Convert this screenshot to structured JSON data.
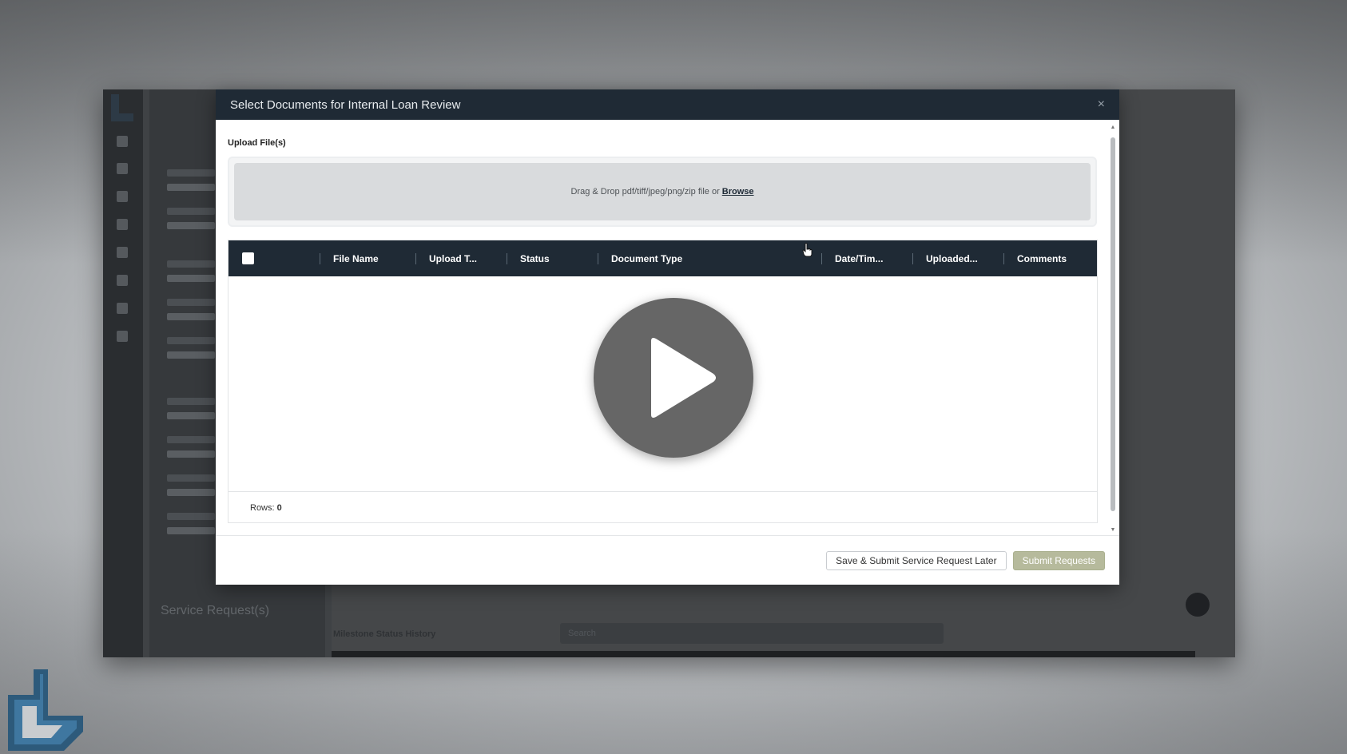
{
  "modal": {
    "title": "Select Documents for Internal Loan Review",
    "close_symbol": "×",
    "upload_label": "Upload File(s)",
    "dropzone_text": "Drag & Drop pdf/tiff/jpeg/png/zip file or",
    "browse_label": "Browse",
    "grid": {
      "columns": [
        "File Name",
        "Upload T...",
        "Status",
        "Document Type",
        "Date/Tim...",
        "Uploaded...",
        "Comments"
      ],
      "rows": [],
      "rows_label": "Rows:",
      "rows_count": "0"
    },
    "buttons": {
      "save_later": "Save & Submit Service Request Later",
      "submit": "Submit Requests"
    }
  },
  "background_app": {
    "service_requests_label": "Service Request(s)",
    "milestone_label": "Milestone Status History",
    "search_placeholder": "Search"
  },
  "colors": {
    "header_navy": "#1f2a35",
    "submit_button": "#b6ba9c",
    "brand_blue": "#2d5a7b"
  },
  "icons": {
    "play": "play-icon",
    "close": "close-icon",
    "cursor": "hand-pointer-icon",
    "logo": "brand-logo-icon"
  }
}
